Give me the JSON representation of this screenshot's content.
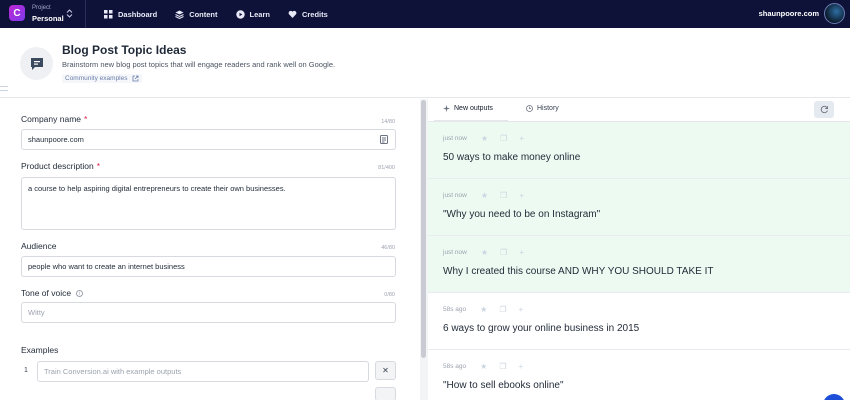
{
  "nav": {
    "logo_letter": "C",
    "project_label": "Project",
    "project_name": "Personal",
    "items": [
      {
        "label": "Dashboard",
        "icon": "grid-icon"
      },
      {
        "label": "Content",
        "icon": "stack-icon"
      },
      {
        "label": "Learn",
        "icon": "play-icon"
      },
      {
        "label": "Credits",
        "icon": "heart-icon"
      }
    ],
    "username": "shaunpoore.com"
  },
  "tool": {
    "title": "Blog Post Topic Ideas",
    "description": "Brainstorm new blog post topics that will engage readers and rank well on Google.",
    "community_link": "Community examples"
  },
  "form": {
    "company": {
      "label": "Company name",
      "required": "*",
      "count": "14/80",
      "value": "shaunpoore.com"
    },
    "product": {
      "label": "Product description",
      "required": "*",
      "count": "81/400",
      "value": "a course to help aspiring digital entrepreneurs to create their own businesses."
    },
    "audience": {
      "label": "Audience",
      "count": "46/80",
      "value": "people who want to create an internet business"
    },
    "tone": {
      "label": "Tone of voice",
      "count": "0/80",
      "placeholder": "Witty",
      "info_glyph": "i"
    },
    "examples": {
      "label": "Examples",
      "rows": [
        {
          "num": "1",
          "placeholder": "Train Conversion.ai with example outputs",
          "remove": "✕"
        }
      ]
    }
  },
  "outputs": {
    "tabs": [
      {
        "label": "New outputs",
        "active": true
      },
      {
        "label": "History",
        "active": false
      }
    ],
    "items": [
      {
        "time": "just now",
        "text": "50 ways to make money online",
        "fresh": true
      },
      {
        "time": "just now",
        "text": "\"Why you need to be on Instagram\"",
        "fresh": true
      },
      {
        "time": "just now",
        "text": "Why I created this course AND WHY YOU SHOULD TAKE IT",
        "fresh": true
      },
      {
        "time": "58s ago",
        "text": "6 ways to grow your online business in 2015",
        "fresh": false
      },
      {
        "time": "58s ago",
        "text": "\"How to sell ebooks online\"",
        "fresh": false
      }
    ]
  },
  "colors": {
    "nav_bg": "#0f1238",
    "fresh_bg": "#edfaf1",
    "required": "#e11d48"
  }
}
